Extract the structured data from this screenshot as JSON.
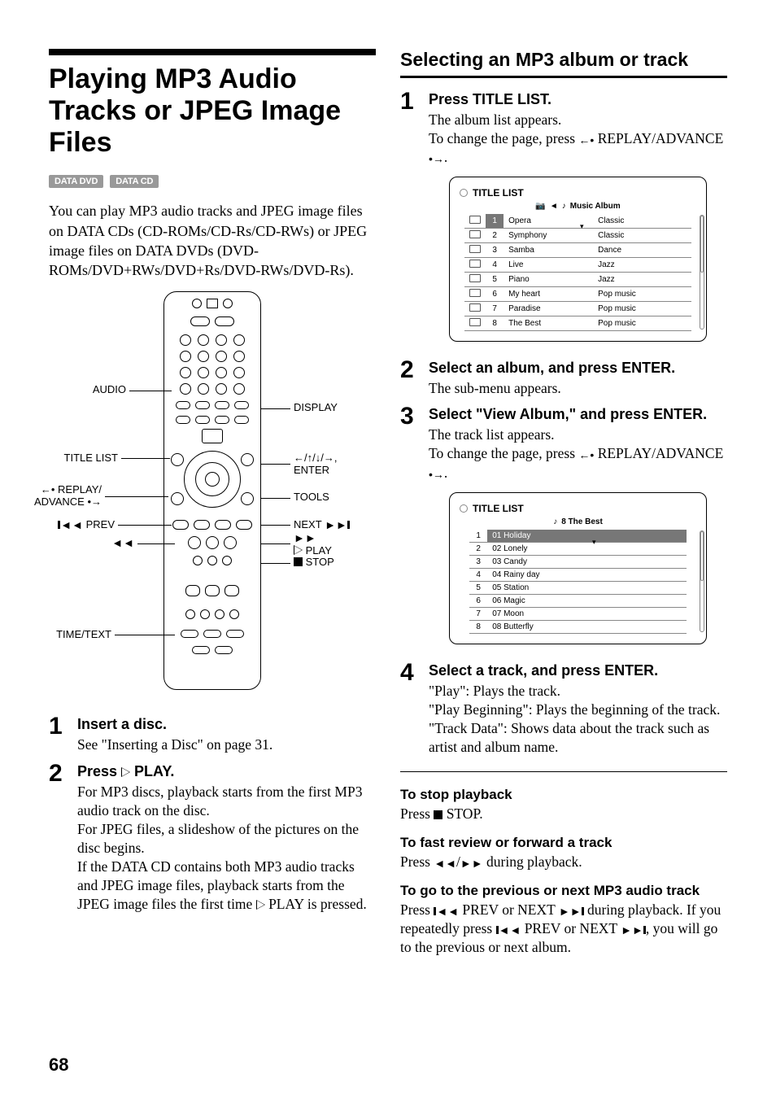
{
  "page_number": "68",
  "left": {
    "title": "Playing MP3 Audio Tracks or JPEG Image Files",
    "badges": [
      "DATA DVD",
      "DATA CD"
    ],
    "intro": "You can play MP3 audio tracks and JPEG image files on DATA CDs (CD-ROMs/CD-Rs/CD-RWs) or JPEG image files on DATA DVDs (DVD-ROMs/DVD+RWs/DVD+Rs/DVD-RWs/DVD-Rs).",
    "remote_labels": {
      "audio": "AUDIO",
      "display": "DISPLAY",
      "title_list": "TITLE LIST",
      "arrows_enter": "←/↑/↓/→,\nENTER",
      "replay_advance": "←• REPLAY/\nADVANCE •→",
      "tools": "TOOLS",
      "prev": "PREV",
      "next": "NEXT",
      "play_sym": "PLAY",
      "rew": "◄◄",
      "ff": "►►",
      "stop": "STOP",
      "time_text": "TIME/TEXT"
    },
    "steps": [
      {
        "n": "1",
        "head": "Insert a disc.",
        "txt": "See \"Inserting a Disc\" on page 31."
      },
      {
        "n": "2",
        "head_prefix": "Press ",
        "head_suffix": " PLAY.",
        "txt": "For MP3 discs, playback starts from the first MP3 audio track on the disc.\nFor JPEG files, a slideshow of the pictures on the disc begins.\nIf the DATA CD contains both MP3 audio tracks and JPEG image files, playback starts from the JPEG image files the first time  PLAY is pressed."
      }
    ]
  },
  "right": {
    "section_title": "Selecting an MP3 album or track",
    "steps": [
      {
        "n": "1",
        "head": "Press TITLE LIST.",
        "txt_a": "The album list appears.",
        "txt_b_pre": "To change the page, press ",
        "txt_b_mid": " REPLAY/ADVANCE ",
        "txt_b_post": "."
      },
      {
        "n": "2",
        "head": "Select an album, and press ENTER.",
        "txt": "The sub-menu appears."
      },
      {
        "n": "3",
        "head": "Select \"View Album,\" and press ENTER.",
        "txt_a": "The track list appears.",
        "txt_b_pre": "To change the page, press ",
        "txt_b_mid": " REPLAY/ADVANCE ",
        "txt_b_post": "."
      },
      {
        "n": "4",
        "head": "Select a track, and press ENTER.",
        "txt": "\"Play\": Plays the track.\n\"Play Beginning\": Plays the beginning of the track.\n\"Track Data\": Shows data about the track such as artist and album name."
      }
    ],
    "album_panel": {
      "title": "TITLE LIST",
      "breadcrumb": "Music Album",
      "rows": [
        [
          "1",
          "Opera",
          "Classic"
        ],
        [
          "2",
          "Symphony",
          "Classic"
        ],
        [
          "3",
          "Samba",
          "Dance"
        ],
        [
          "4",
          "Live",
          "Jazz"
        ],
        [
          "5",
          "Piano",
          "Jazz"
        ],
        [
          "6",
          "My heart",
          "Pop music"
        ],
        [
          "7",
          "Paradise",
          "Pop music"
        ],
        [
          "8",
          "The Best",
          "Pop music"
        ]
      ]
    },
    "track_panel": {
      "title": "TITLE LIST",
      "breadcrumb": "8  The Best",
      "rows": [
        [
          "1",
          "01 Holiday"
        ],
        [
          "2",
          "02 Lonely"
        ],
        [
          "3",
          "03 Candy"
        ],
        [
          "4",
          "04 Rainy day"
        ],
        [
          "5",
          "05 Station"
        ],
        [
          "6",
          "06 Magic"
        ],
        [
          "7",
          "07 Moon"
        ],
        [
          "8",
          "08 Butterfly"
        ]
      ]
    },
    "after": {
      "stop_head": "To stop playback",
      "stop_txt_pre": "Press ",
      "stop_txt_post": " STOP.",
      "ff_head": "To fast review or forward a track",
      "ff_txt_pre": "Press ",
      "ff_txt_post": " during playback.",
      "skip_head": "To go to the previous or next MP3 audio track",
      "skip_txt": "Press |◄◄ PREV or NEXT ►►| during playback. If you repeatedly press |◄◄ PREV or NEXT ►►|, you will go to the previous or next album."
    }
  }
}
